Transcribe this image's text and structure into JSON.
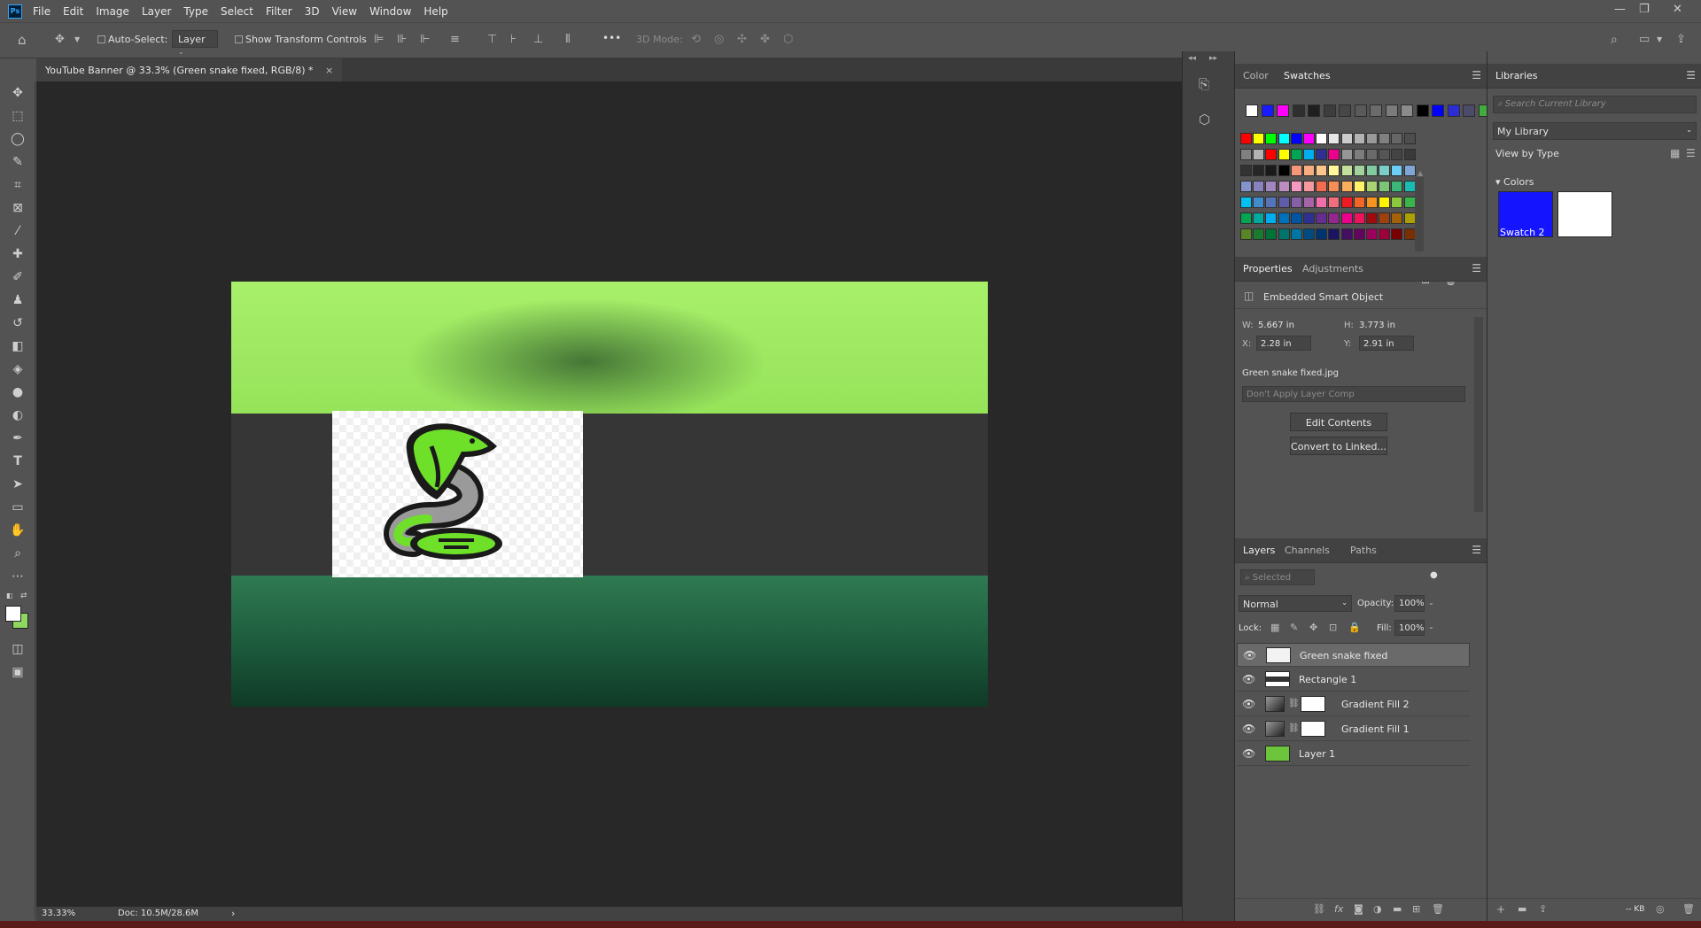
{
  "app": {
    "logo_text": "Ps"
  },
  "menu": {
    "items": [
      "File",
      "Edit",
      "Image",
      "Layer",
      "Type",
      "Select",
      "Filter",
      "3D",
      "View",
      "Window",
      "Help"
    ]
  },
  "window_controls": {
    "minimize": "—",
    "restore": "❐",
    "close": "✕"
  },
  "options_bar": {
    "auto_select_label": "Auto-Select:",
    "auto_select_value": "Layer",
    "show_transform_label": "Show Transform Controls",
    "mode_3d_label": "3D Mode:",
    "more_label": "•••"
  },
  "document": {
    "tab_title": "YouTube Banner @ 33.3% (Green snake fixed, RGB/8) *",
    "tab_close": "×"
  },
  "status": {
    "zoom": "33.33%",
    "doc": "Doc: 10.5M/28.6M",
    "arrow": "›"
  },
  "color_panel": {
    "tabs": [
      "Color",
      "Swatches"
    ],
    "recent": [
      "#ffffff",
      "#1a1aff",
      "#ff00ff",
      "#2f2f2f",
      "#1f1f1f",
      "#3d3d3d",
      "#474747",
      "#5a5a5a",
      "#6b6b6b",
      "#7b7b7b",
      "#8a8a8a",
      "#000000",
      "#0000ff",
      "#2d2dd4",
      "#4b4b6a",
      "#3fae3f",
      "#5fcc2f"
    ],
    "grid": [
      [
        "#ff0000",
        "#ffff00",
        "#00ff00",
        "#00ffff",
        "#0000ff",
        "#ff00ff",
        "#ffffff",
        "#e6e6e6",
        "#cccccc",
        "#b3b3b3",
        "#999999",
        "#808080",
        "#666666",
        "#4d4d4d"
      ],
      [
        "#808080",
        "#b3b3b3",
        "#ff0000",
        "#ffff00",
        "#00a651",
        "#00aeef",
        "#2e3192",
        "#ec008c",
        "#969696",
        "#7d7d7d",
        "#6a6a6a",
        "#555555",
        "#444444",
        "#3a3a3a"
      ],
      [
        "#333333",
        "#262626",
        "#1a1a1a",
        "#000000",
        "#f7977a",
        "#f9ad81",
        "#fdc68a",
        "#fff79a",
        "#c4df9b",
        "#a3d39c",
        "#82ca9d",
        "#7bcdc8",
        "#6ecff6",
        "#7ea7d8"
      ],
      [
        "#8493ca",
        "#8882be",
        "#a187be",
        "#bc8dbf",
        "#f49ac2",
        "#f6989d",
        "#f26c4f",
        "#f68e55",
        "#fbaf5c",
        "#fff467",
        "#acd372",
        "#7cc576",
        "#3bb878",
        "#1abbb4"
      ],
      [
        "#00bff3",
        "#438ccb",
        "#5574b9",
        "#605ca8",
        "#855fa8",
        "#a763a8",
        "#f06eaa",
        "#f26d7d",
        "#ed1c24",
        "#f26522",
        "#f7941d",
        "#fff200",
        "#8dc73f",
        "#39b54a"
      ],
      [
        "#00a651",
        "#00a99d",
        "#00aeef",
        "#0072bc",
        "#0054a6",
        "#2e3192",
        "#662d91",
        "#92278f",
        "#ec008c",
        "#ed145b",
        "#9e0b0f",
        "#a0410d",
        "#a36209",
        "#aba000"
      ],
      [
        "#598527",
        "#1a7b30",
        "#007236",
        "#00746b",
        "#0076a3",
        "#004b80",
        "#003471",
        "#1b1464",
        "#440e62",
        "#630460",
        "#9e005d",
        "#9e0039",
        "#790000",
        "#7b2e00"
      ]
    ]
  },
  "properties_panel": {
    "tabs": [
      "Properties",
      "Adjustments"
    ],
    "type_label": "Embedded Smart Object",
    "w_label": "W:",
    "w_value": "5.667 in",
    "h_label": "H:",
    "h_value": "3.773 in",
    "x_label": "X:",
    "x_value": "2.28 in",
    "y_label": "Y:",
    "y_value": "2.91 in",
    "filename": "Green snake fixed.jpg",
    "layer_comp_placeholder": "Don't Apply Layer Comp",
    "edit_contents_label": "Edit Contents",
    "convert_label": "Convert to Linked..."
  },
  "layers_panel": {
    "tabs": [
      "Layers",
      "Channels",
      "Paths"
    ],
    "filter_placeholder": "Selected",
    "blend_mode": "Normal",
    "opacity_label": "Opacity:",
    "opacity_value": "100%",
    "lock_label": "Lock:",
    "fill_label": "Fill:",
    "fill_value": "100%",
    "layers": [
      {
        "name": "Green snake fixed",
        "selected": true,
        "kind": "smart"
      },
      {
        "name": "Rectangle 1",
        "selected": false,
        "kind": "shape"
      },
      {
        "name": "Gradient Fill 2",
        "selected": false,
        "kind": "gradient"
      },
      {
        "name": "Gradient Fill 1",
        "selected": false,
        "kind": "gradient"
      },
      {
        "name": "Layer 1",
        "selected": false,
        "kind": "fill",
        "color": "#6cc53b"
      }
    ]
  },
  "libraries_panel": {
    "title": "Libraries",
    "search_placeholder": "Search Current Library",
    "library_name": "My Library",
    "view_by": "View by Type",
    "section": "Colors",
    "swatches": [
      {
        "name": "Swatch 2",
        "color": "#1414ff"
      },
      {
        "name": "",
        "color": "#ffffff"
      }
    ],
    "footer_kb": "-- KB"
  },
  "tools": {
    "foreground": "#ffffff",
    "background": "#8fd85f"
  }
}
